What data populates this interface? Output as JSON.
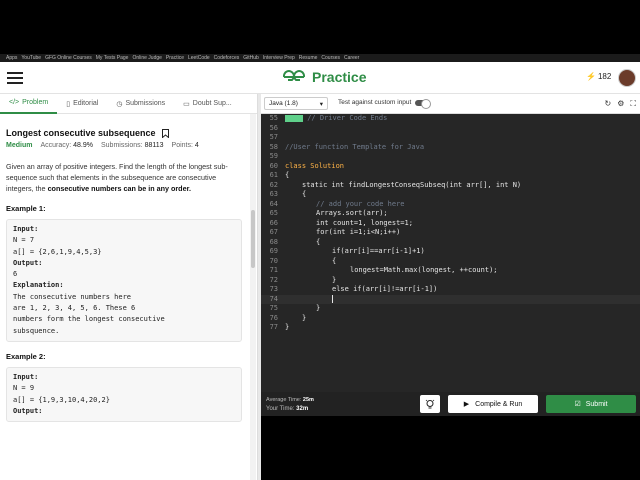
{
  "bookmarks": [
    "Apps",
    "YouTube",
    "GFG Online Courses",
    "My Tests Page",
    "Online Judge",
    "Practice",
    "LeetCode",
    "Codeforces",
    "GitHub",
    "Interview Prep",
    "Resume",
    "Courses",
    "Career"
  ],
  "brand": {
    "name": "Practice",
    "color": "#2f8d46"
  },
  "user": {
    "streak": "182"
  },
  "tabs": [
    {
      "label": "Problem",
      "icon": "</>"
    },
    {
      "label": "Editorial",
      "icon": "▯"
    },
    {
      "label": "Submissions",
      "icon": "◷"
    },
    {
      "label": "Doubt Sup...",
      "icon": "▭"
    }
  ],
  "problem": {
    "title": "Longest consecutive subsequence",
    "difficulty": "Medium",
    "accuracy_label": "Accuracy:",
    "accuracy": "48.9%",
    "submissions_label": "Submissions:",
    "submissions": "88113",
    "points_label": "Points:",
    "points": "4",
    "description": "Given an array of positive integers. Find the length of the longest sub-sequence such that elements in the subsequence are consecutive integers, the",
    "description_bold": "consecutive numbers can be in any order.",
    "example1": {
      "title": "Example 1:",
      "input_label": "Input:",
      "input": "N = 7\na[] = {2,6,1,9,4,5,3}",
      "output_label": "Output:",
      "output": "6",
      "explanation_label": "Explanation:",
      "explanation": "The consecutive numbers here\nare 1, 2, 3, 4, 5, 6. These 6\nnumbers form the longest consecutive\nsubsquence."
    },
    "example2": {
      "title": "Example 2:",
      "input_label": "Input:",
      "input": "N = 9\na[] = {1,9,3,10,4,20,2}",
      "output_label": "Output:"
    }
  },
  "editor": {
    "language": "Java (1.8)",
    "custom_input_label": "Test against custom input",
    "lines": [
      {
        "n": "55",
        "text": "// Driver Code Ends"
      },
      {
        "n": "56",
        "text": ""
      },
      {
        "n": "57",
        "text": ""
      },
      {
        "n": "58",
        "text": "//User function Template for Java"
      },
      {
        "n": "59",
        "text": ""
      },
      {
        "n": "60",
        "text": "class Solution"
      },
      {
        "n": "61",
        "text": "{"
      },
      {
        "n": "62",
        "text": "static int findLongestConseqSubseq(int arr[], int N)"
      },
      {
        "n": "63",
        "text": "{"
      },
      {
        "n": "64",
        "text": "// add your code here"
      },
      {
        "n": "65",
        "text": "Arrays.sort(arr);"
      },
      {
        "n": "66",
        "text": "int count=1, longest=1;"
      },
      {
        "n": "67",
        "text": "for(int i=1;i<N;i++)"
      },
      {
        "n": "68",
        "text": "{"
      },
      {
        "n": "69",
        "text": "if(arr[i]==arr[i-1]+1)"
      },
      {
        "n": "70",
        "text": "{"
      },
      {
        "n": "71",
        "text": "longest=Math.max(longest, ++count);"
      },
      {
        "n": "72",
        "text": "}"
      },
      {
        "n": "73",
        "text": "else if(arr[i]!=arr[i-1])"
      },
      {
        "n": "74",
        "text": ""
      },
      {
        "n": "75",
        "text": "}"
      },
      {
        "n": "76",
        "text": "}"
      },
      {
        "n": "77",
        "text": "}"
      }
    ]
  },
  "footer": {
    "avg_time_label": "Average Time:",
    "avg_time": "25m",
    "your_time_label": "Your Time:",
    "your_time": "32m",
    "compile_label": "Compile & Run",
    "submit_label": "Submit"
  }
}
